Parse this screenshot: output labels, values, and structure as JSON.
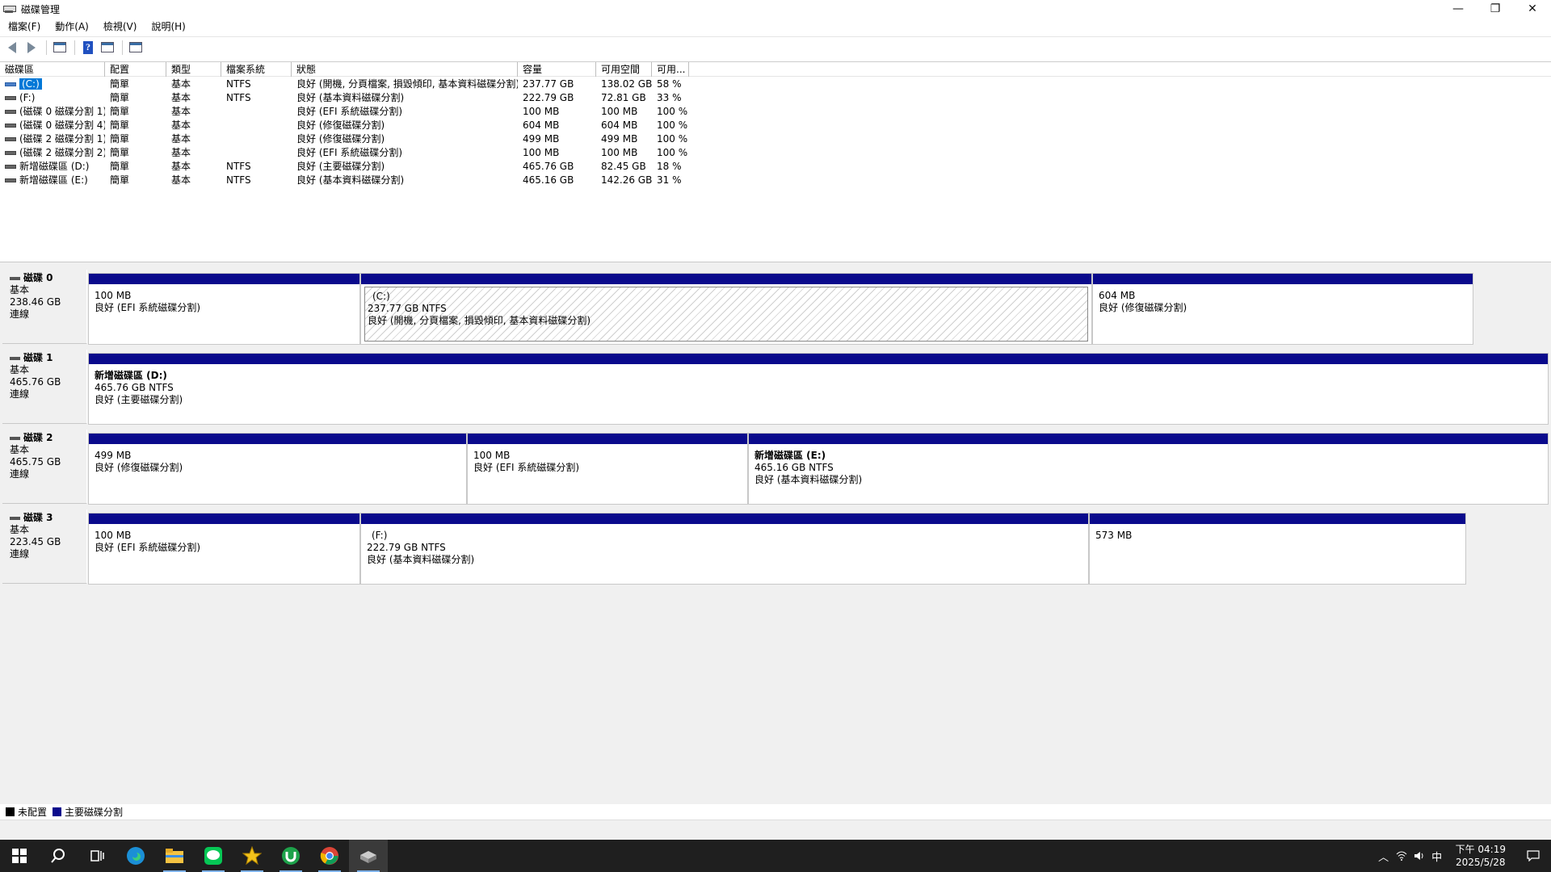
{
  "window": {
    "title": "磁碟管理",
    "minimize": "—",
    "restore": "❐",
    "close": "✕"
  },
  "menu": [
    "檔案(F)",
    "動作(A)",
    "檢視(V)",
    "說明(H)"
  ],
  "volume_list": {
    "columns": [
      "磁碟區",
      "配置",
      "類型",
      "檔案系統",
      "狀態",
      "容量",
      "可用空間",
      "可用..."
    ],
    "rows": [
      [
        "(C:)",
        "簡單",
        "基本",
        "NTFS",
        "良好 (開機, 分頁檔案, 損毀傾印, 基本資料磁碟分割)",
        "237.77 GB",
        "138.02 GB",
        "58 %"
      ],
      [
        "(F:)",
        "簡單",
        "基本",
        "NTFS",
        "良好 (基本資料磁碟分割)",
        "222.79 GB",
        "72.81 GB",
        "33 %"
      ],
      [
        "(磁碟 0 磁碟分割 1)",
        "簡單",
        "基本",
        "",
        "良好 (EFI 系統磁碟分割)",
        "100 MB",
        "100 MB",
        "100 %"
      ],
      [
        "(磁碟 0 磁碟分割 4)",
        "簡單",
        "基本",
        "",
        "良好 (修復磁碟分割)",
        "604 MB",
        "604 MB",
        "100 %"
      ],
      [
        "(磁碟 2 磁碟分割 1)",
        "簡單",
        "基本",
        "",
        "良好 (修復磁碟分割)",
        "499 MB",
        "499 MB",
        "100 %"
      ],
      [
        "(磁碟 2 磁碟分割 2)",
        "簡單",
        "基本",
        "",
        "良好 (EFI 系統磁碟分割)",
        "100 MB",
        "100 MB",
        "100 %"
      ],
      [
        "新增磁碟區 (D:)",
        "簡單",
        "基本",
        "NTFS",
        "良好 (主要磁碟分割)",
        "465.76 GB",
        "82.45 GB",
        "18 %"
      ],
      [
        "新增磁碟區 (E:)",
        "簡單",
        "基本",
        "NTFS",
        "良好 (基本資料磁碟分割)",
        "465.16 GB",
        "142.26 GB",
        "31 %"
      ]
    ]
  },
  "disks": [
    {
      "name": "磁碟 0",
      "type": "基本",
      "size": "238.46 GB",
      "status": "連線",
      "partitions": [
        {
          "name": "",
          "size": "100 MB",
          "status": "良好 (EFI 系統磁碟分割)"
        },
        {
          "name": "(C:)",
          "size": "237.77 GB NTFS",
          "status": "良好 (開機, 分頁檔案, 損毀傾印, 基本資料磁碟分割)"
        },
        {
          "name": "",
          "size": "604 MB",
          "status": "良好 (修復磁碟分割)"
        }
      ]
    },
    {
      "name": "磁碟 1",
      "type": "基本",
      "size": "465.76 GB",
      "status": "連線",
      "partitions": [
        {
          "name": "新增磁碟區  (D:)",
          "size": "465.76 GB NTFS",
          "status": "良好 (主要磁碟分割)"
        }
      ]
    },
    {
      "name": "磁碟 2",
      "type": "基本",
      "size": "465.75 GB",
      "status": "連線",
      "partitions": [
        {
          "name": "",
          "size": "499 MB",
          "status": "良好 (修復磁碟分割)"
        },
        {
          "name": "",
          "size": "100 MB",
          "status": "良好 (EFI 系統磁碟分割)"
        },
        {
          "name": "新增磁碟區  (E:)",
          "size": "465.16 GB NTFS",
          "status": "良好 (基本資料磁碟分割)"
        }
      ]
    },
    {
      "name": "磁碟 3",
      "type": "基本",
      "size": "223.45 GB",
      "status": "連線",
      "partitions": [
        {
          "name": "",
          "size": "100 MB",
          "status": "良好 (EFI 系統磁碟分割)"
        },
        {
          "name": "(F:)",
          "size": "222.79 GB NTFS",
          "status": "良好 (基本資料磁碟分割)"
        },
        {
          "name": "",
          "size": "573 MB",
          "status": ""
        }
      ]
    }
  ],
  "legend": [
    {
      "label": "未配置",
      "color": "#000000"
    },
    {
      "label": "主要磁碟分割",
      "color": "#0a0a8c"
    }
  ],
  "taskbar": {
    "apps": [
      "start-icon",
      "search-icon",
      "task-view-icon",
      "edge-icon",
      "file-explorer-icon",
      "line-icon",
      "star-app-icon",
      "utorrent-icon",
      "chrome-icon",
      "disk-management-icon"
    ],
    "ime": "中",
    "time": "下午 04:19",
    "date": "2025/5/28"
  }
}
